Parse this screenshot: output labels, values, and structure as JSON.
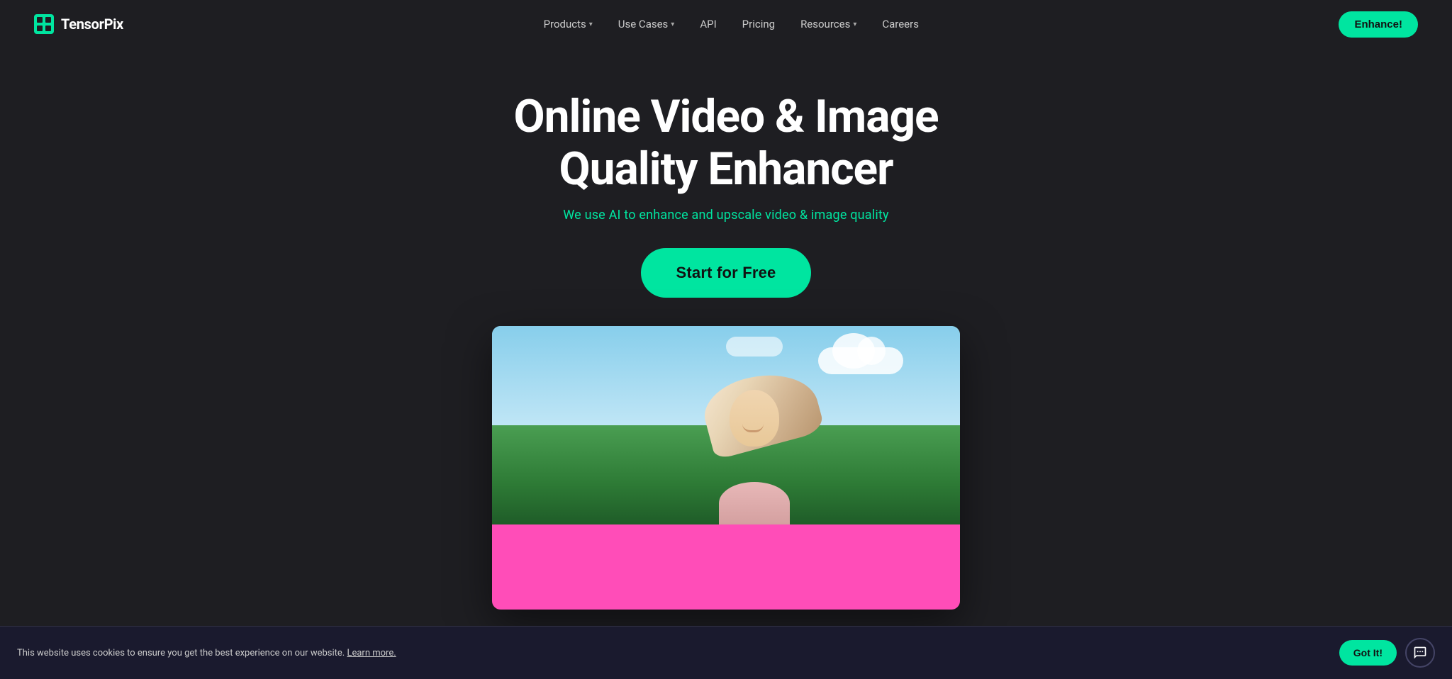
{
  "brand": {
    "name": "TensorPix",
    "logo_alt": "TensorPix logo"
  },
  "navbar": {
    "links": [
      {
        "id": "products",
        "label": "Products",
        "has_dropdown": true
      },
      {
        "id": "use-cases",
        "label": "Use Cases",
        "has_dropdown": true
      },
      {
        "id": "api",
        "label": "API",
        "has_dropdown": false
      },
      {
        "id": "pricing",
        "label": "Pricing",
        "has_dropdown": false
      },
      {
        "id": "resources",
        "label": "Resources",
        "has_dropdown": true
      },
      {
        "id": "careers",
        "label": "Careers",
        "has_dropdown": false
      }
    ],
    "cta_label": "Enhance!"
  },
  "hero": {
    "title": "Online Video & Image Quality Enhancer",
    "subtitle": "We use AI to enhance and upscale video & image quality",
    "cta_label": "Start for Free"
  },
  "cookie_banner": {
    "message": "This website uses cookies to ensure you get the best experience on our website.",
    "learn_more_text": "Learn more.",
    "got_it_label": "Got It!"
  }
}
